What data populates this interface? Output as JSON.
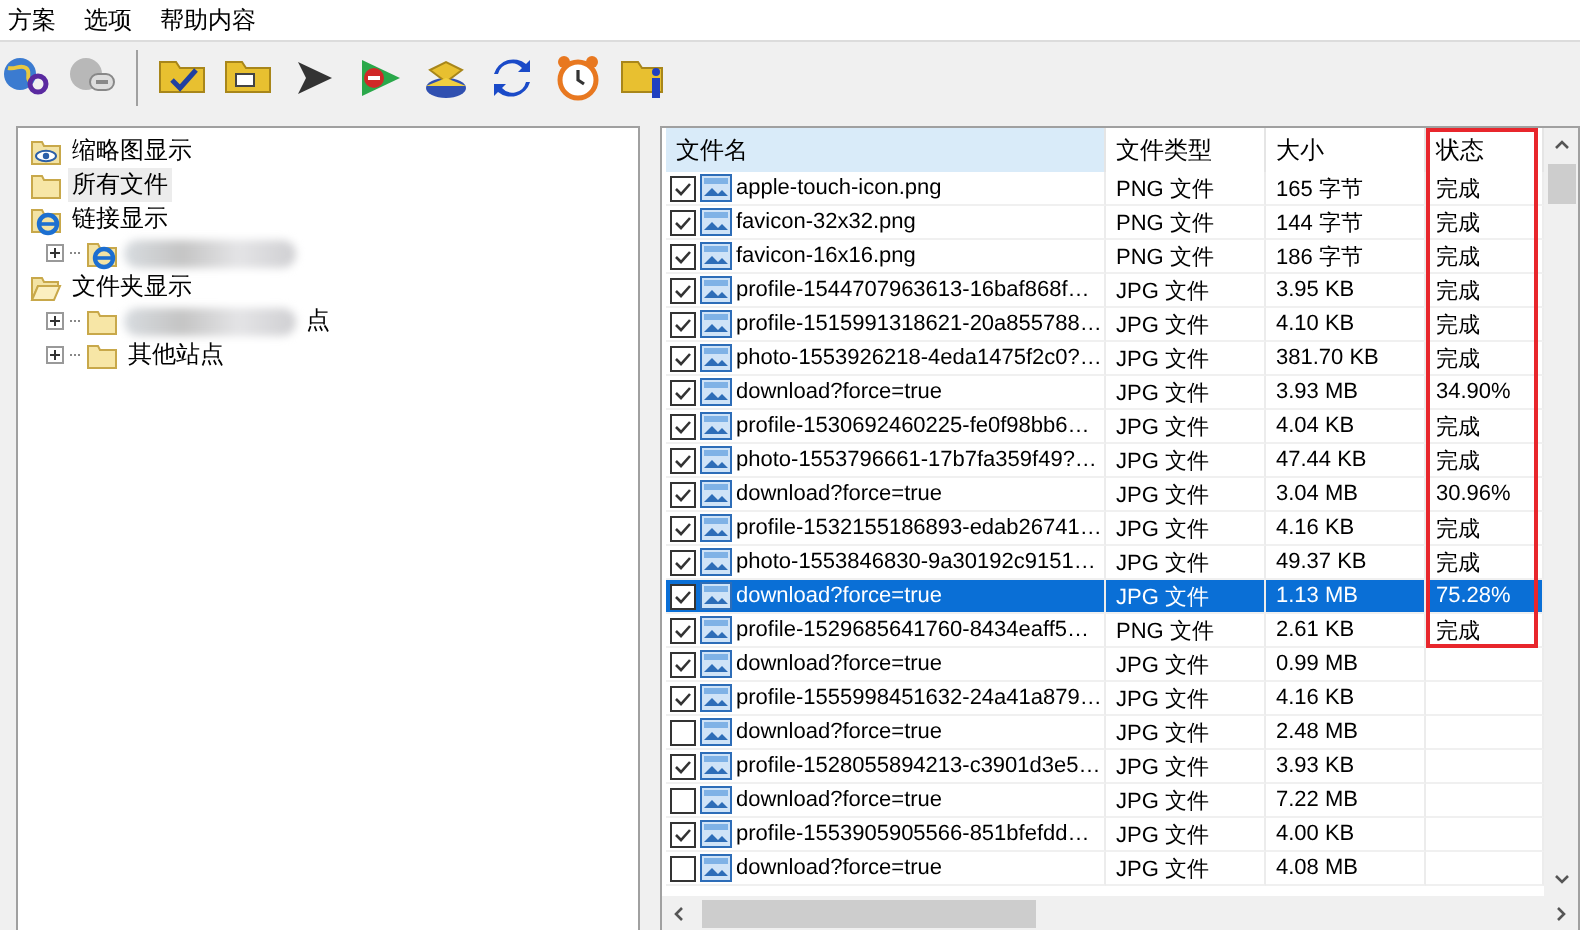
{
  "menu": [
    "方案",
    "选项",
    "帮助内容"
  ],
  "toolbar": [
    {
      "kind": "globe-search"
    },
    {
      "kind": "globe-stop"
    },
    {
      "kind": "separator"
    },
    {
      "kind": "folders-check"
    },
    {
      "kind": "folders"
    },
    {
      "kind": "play"
    },
    {
      "kind": "stop"
    },
    {
      "kind": "stack"
    },
    {
      "kind": "refresh"
    },
    {
      "kind": "clock"
    },
    {
      "kind": "info"
    }
  ],
  "tree": [
    {
      "label": "缩略图显示",
      "kind": "eye-folder",
      "selected": false
    },
    {
      "label": "所有文件",
      "kind": "folder",
      "selected": true
    },
    {
      "label": "链接显示",
      "kind": "ie",
      "selected": false,
      "children": [
        {
          "kind": "ie",
          "blurred": true,
          "selected": false
        }
      ]
    },
    {
      "label": "文件夹显示",
      "kind": "open-folder",
      "selected": false,
      "children": [
        {
          "label": "点",
          "kind": "folder",
          "blurred": true,
          "selected": false
        },
        {
          "label": "其他站点",
          "kind": "folder",
          "blurred": false,
          "selected": false
        }
      ]
    }
  ],
  "table": {
    "columns": [
      "文件名",
      "文件类型",
      "大小",
      "状态"
    ],
    "rows": [
      {
        "checked": true,
        "selected": false,
        "name": "apple-touch-icon.png",
        "type": "PNG 文件",
        "size": "165  字节",
        "status": "完成"
      },
      {
        "checked": true,
        "selected": false,
        "name": "favicon-32x32.png",
        "type": "PNG 文件",
        "size": "144  字节",
        "status": "完成"
      },
      {
        "checked": true,
        "selected": false,
        "name": "favicon-16x16.png",
        "type": "PNG 文件",
        "size": "186  字节",
        "status": "完成"
      },
      {
        "checked": true,
        "selected": false,
        "name": "profile-1544707963613-16baf868f…",
        "type": "JPG 文件",
        "size": "3.95  KB",
        "status": "完成"
      },
      {
        "checked": true,
        "selected": false,
        "name": "profile-1515991318621-20a855788…",
        "type": "JPG 文件",
        "size": "4.10  KB",
        "status": "完成"
      },
      {
        "checked": true,
        "selected": false,
        "name": "photo-1553926218-4eda1475f2c0?…",
        "type": "JPG 文件",
        "size": "381.70  KB",
        "status": "完成"
      },
      {
        "checked": true,
        "selected": false,
        "name": "download?force=true",
        "type": "JPG 文件",
        "size": "3.93  MB",
        "status": "34.90%"
      },
      {
        "checked": true,
        "selected": false,
        "name": "profile-1530692460225-fe0f98bb6…",
        "type": "JPG 文件",
        "size": "4.04  KB",
        "status": "完成"
      },
      {
        "checked": true,
        "selected": false,
        "name": "photo-1553796661-17b7fa359f49?…",
        "type": "JPG 文件",
        "size": "47.44  KB",
        "status": "完成"
      },
      {
        "checked": true,
        "selected": false,
        "name": "download?force=true",
        "type": "JPG 文件",
        "size": "3.04  MB",
        "status": "30.96%"
      },
      {
        "checked": true,
        "selected": false,
        "name": "profile-1532155186893-edab26741…",
        "type": "JPG 文件",
        "size": "4.16  KB",
        "status": "完成"
      },
      {
        "checked": true,
        "selected": false,
        "name": "photo-1553846830-9a30192c9151…",
        "type": "JPG 文件",
        "size": "49.37  KB",
        "status": "完成"
      },
      {
        "checked": true,
        "selected": true,
        "name": "download?force=true",
        "type": "JPG 文件",
        "size": "1.13  MB",
        "status": "75.28%"
      },
      {
        "checked": true,
        "selected": false,
        "name": "profile-1529685641760-8434eaff5…",
        "type": "PNG 文件",
        "size": "2.61  KB",
        "status": "完成"
      },
      {
        "checked": true,
        "selected": false,
        "name": "download?force=true",
        "type": "JPG 文件",
        "size": "0.99  MB"
      },
      {
        "checked": true,
        "selected": false,
        "name": "profile-1555998451632-24a41a879…",
        "type": "JPG 文件",
        "size": "4.16  KB"
      },
      {
        "checked": false,
        "selected": false,
        "name": "download?force=true",
        "type": "JPG 文件",
        "size": "2.48  MB"
      },
      {
        "checked": true,
        "selected": false,
        "name": "profile-1528055894213-c3901d3e5…",
        "type": "JPG 文件",
        "size": "3.93  KB"
      },
      {
        "checked": false,
        "selected": false,
        "name": "download?force=true",
        "type": "JPG 文件",
        "size": "7.22  MB"
      },
      {
        "checked": true,
        "selected": false,
        "name": "profile-1553905905566-851bfefdd…",
        "type": "JPG 文件",
        "size": "4.00  KB"
      },
      {
        "checked": false,
        "selected": false,
        "name": "download?force=true",
        "type": "JPG 文件",
        "size": "4.08  MB"
      }
    ]
  }
}
